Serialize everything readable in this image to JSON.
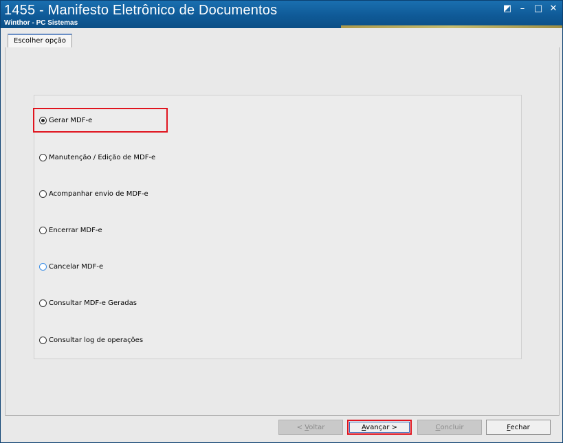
{
  "window": {
    "title": "1455 - Manifesto Eletrônico de Documentos",
    "subtitle": "Winthor - PC Sistemas",
    "controls": {
      "restore": "◩",
      "minimize": "–",
      "maximize": "□",
      "close": "✕"
    }
  },
  "tabs": [
    {
      "label": "Escolher opção",
      "active": true
    }
  ],
  "options": [
    {
      "label": "Gerar MDF-e",
      "checked": true
    },
    {
      "label": "Manutenção / Edição de MDF-e",
      "checked": false
    },
    {
      "label": "Acompanhar envio de MDF-e",
      "checked": false
    },
    {
      "label": "Encerrar MDF-e",
      "checked": false
    },
    {
      "label": "Cancelar MDF-e",
      "checked": false
    },
    {
      "label": "Consultar MDF-e Geradas",
      "checked": false
    },
    {
      "label": "Consultar log de operações",
      "checked": false
    }
  ],
  "footer": {
    "voltar": {
      "pre": "< ",
      "key": "V",
      "rest": "oltar",
      "enabled": false
    },
    "avancar": {
      "key": "A",
      "rest": "vançar >",
      "enabled": true
    },
    "concluir": {
      "key": "C",
      "rest": "oncluir",
      "enabled": false
    },
    "fechar": {
      "key": "F",
      "rest": "echar",
      "enabled": true
    }
  },
  "colors": {
    "titlebar": "#1a6fb0",
    "highlight": "#e0141e",
    "tab_accent": "#6a8fc6"
  }
}
